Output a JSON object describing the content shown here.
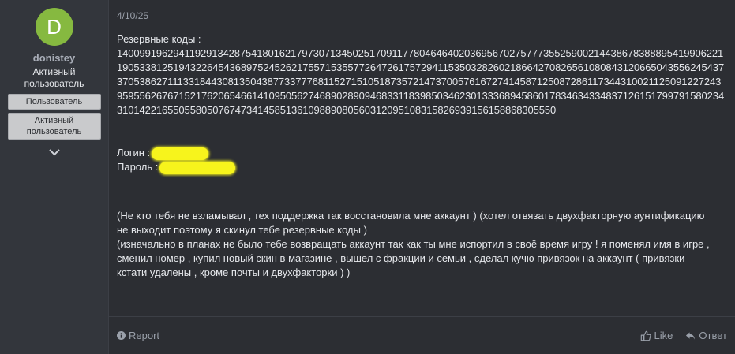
{
  "user": {
    "avatar_letter": "D",
    "avatar_color": "#86b940",
    "name": "donistey",
    "title": "Активный пользователь",
    "banners": [
      "Пользователь",
      "Активный пользователь"
    ]
  },
  "post": {
    "date": "4/10/25",
    "codes_label": "Резервные коды :",
    "codes": "140099196294119291342875418016217973071345025170911778046464020369567027577735525900214438678388895419906221190533812519432264543689752452621755715355772647261757294115350328260218664270826561080843120665043556245437370538627111331844308135043877337776811527151051873572147370057616727414587125087286117344310021125091227243959556267671521762065466141095056274689028909468331183985034623013336894586017834634334837126151799791580234310142216550558050767473414585136109889080560312095108315826939156158868305550",
    "login_label": "Логин :",
    "password_label": "Пароль :",
    "message_lines": [
      "(Не кто тебя не взламывал , тех поддержка так восстановила мне аккаунт ) (хотел отвязать двухфакторную аунтификацию не выходит поэтому я скинул тебе резервные коды )",
      "(изначально в планах не было тебе возвращать аккаунт так как ты мне испортил в своё время игру ! я поменял имя в игре , сменил номер , купил новый скин в магазине , вышел с фракции и семьи , сделал кучю привязок на аккаунт ( привязки кстати удалены , кроме почты и двухфакторки ) )"
    ]
  },
  "footer": {
    "report_label": "Report",
    "like_label": "Like",
    "reply_label": "Ответ"
  },
  "colors": {
    "background": "#2c2e33",
    "sidebar": "#33363c",
    "text": "#e6e8ec",
    "muted": "#9aa0aa",
    "redaction": "#f7f41c"
  },
  "icons": {
    "report": "info-circle-icon",
    "like": "thumbs-up-icon",
    "reply": "reply-arrow-icon",
    "expand": "chevron-down-icon"
  }
}
